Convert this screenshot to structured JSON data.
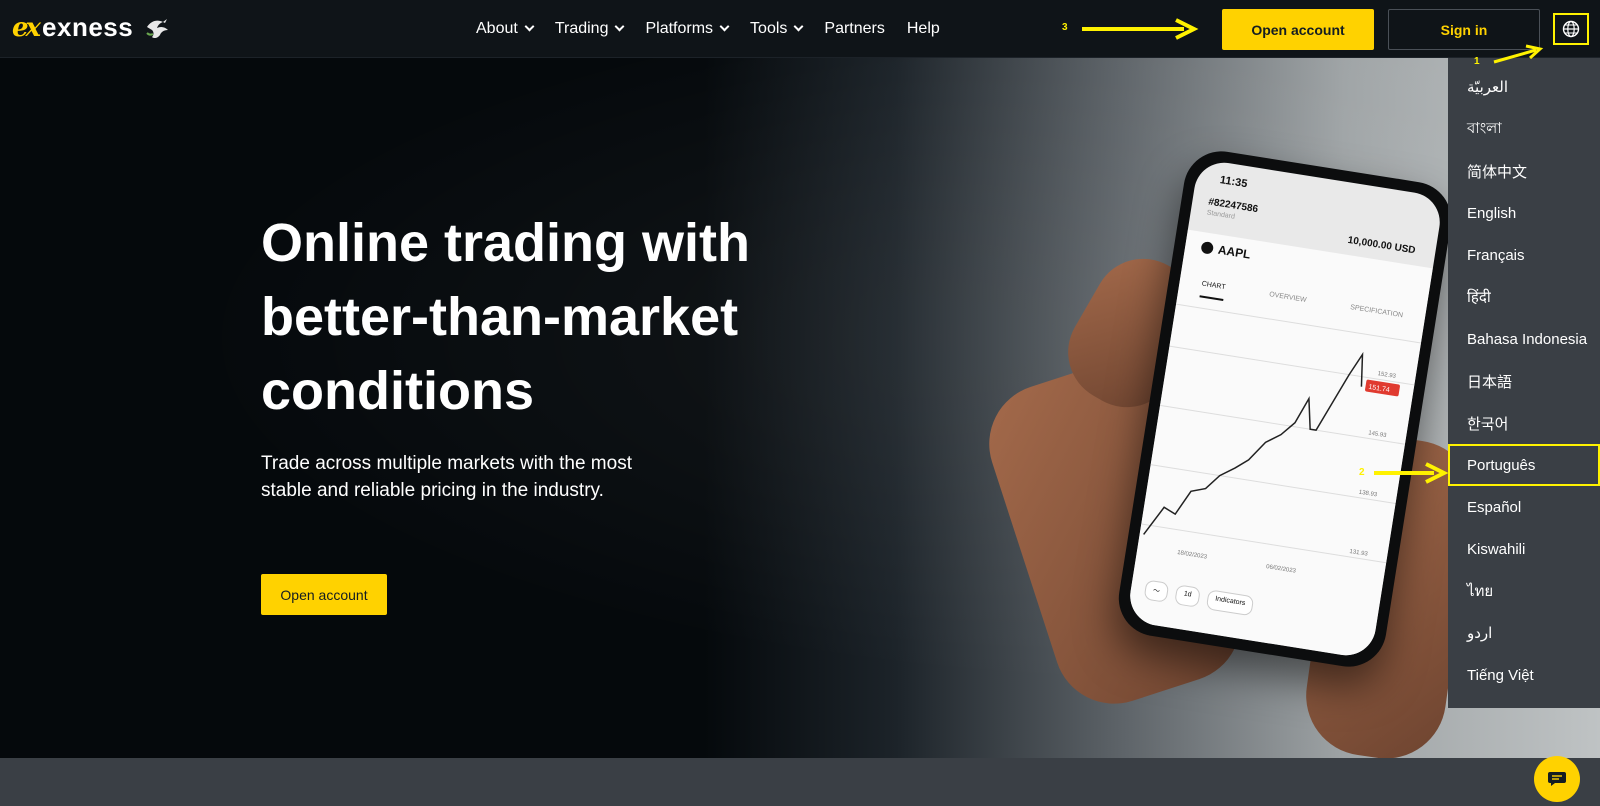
{
  "brand": {
    "name": "exness",
    "mark": "ex"
  },
  "nav": {
    "items": [
      {
        "label": "About",
        "dropdown": true
      },
      {
        "label": "Trading",
        "dropdown": true
      },
      {
        "label": "Platforms",
        "dropdown": true
      },
      {
        "label": "Tools",
        "dropdown": true
      },
      {
        "label": "Partners",
        "dropdown": false
      },
      {
        "label": "Help",
        "dropdown": false
      }
    ],
    "open_account": "Open account",
    "sign_in": "Sign in"
  },
  "annotations": {
    "n1": "1",
    "n2": "2",
    "n3": "3",
    "color": "#fff200"
  },
  "hero": {
    "title": "Online trading with better-than-market conditions",
    "subtitle": "Trade across multiple markets with the most stable and reliable pricing in the industry.",
    "cta": "Open account"
  },
  "phone": {
    "time": "11:35",
    "account": "#82247586",
    "account_type": "Standard",
    "balance": "10,000.00 USD",
    "symbol": "AAPL",
    "tabs": [
      "CHART",
      "OVERVIEW",
      "SPECIFICATION"
    ],
    "price_tag": "151.74",
    "prices": [
      "152.93",
      "145.93",
      "138.93",
      "131.93"
    ],
    "dates": [
      "18/02/2023",
      "06/02/2023"
    ],
    "controls": [
      "1d",
      "Indicators"
    ]
  },
  "languages": [
    "العربيّة",
    "বাংলা",
    "简体中文",
    "English",
    "Français",
    "हिंदी",
    "Bahasa Indonesia",
    "日本語",
    "한국어",
    "Português",
    "Español",
    "Kiswahili",
    "ไทย",
    "اردو",
    "Tiếng Việt"
  ],
  "selected_language": "Português",
  "colors": {
    "accent": "#ffd200",
    "nav_bg": "#0f1418",
    "menu_bg": "#3a3f45",
    "annotation": "#fff200"
  }
}
